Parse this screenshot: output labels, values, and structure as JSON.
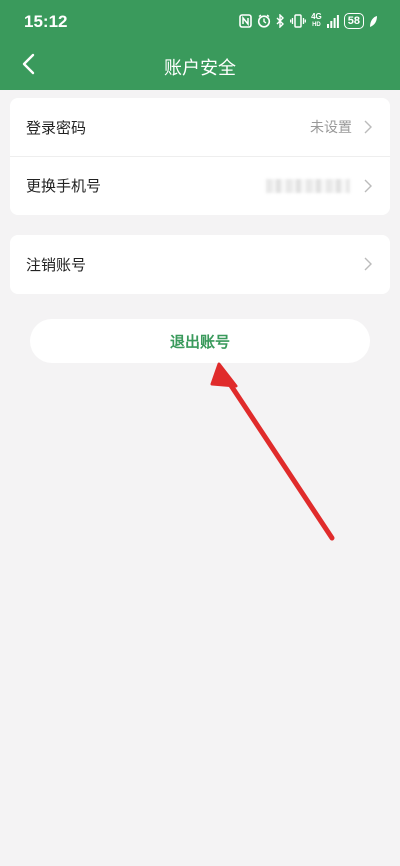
{
  "status_bar": {
    "time": "15:12",
    "network_label_top": "4G",
    "network_label_bottom": "HD",
    "battery": "58"
  },
  "nav": {
    "title": "账户安全",
    "back_icon": "chevron-left-icon"
  },
  "security_items": [
    {
      "label": "登录密码",
      "value": "未设置"
    },
    {
      "label": "更换手机号",
      "value": ""
    }
  ],
  "account_items": [
    {
      "label": "注销账号"
    }
  ],
  "logout": {
    "label": "退出账号"
  },
  "colors": {
    "header": "#3a9a5c",
    "background": "#f4f3f4",
    "accent_text": "#3a9a5c",
    "annotation_arrow": "#e02b2b"
  }
}
